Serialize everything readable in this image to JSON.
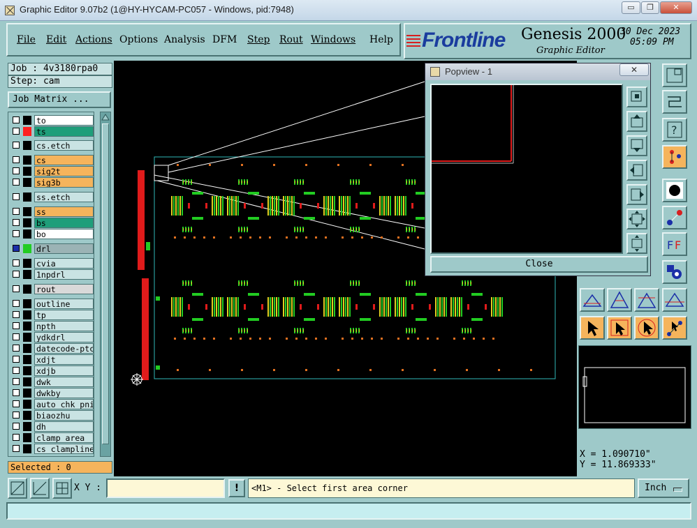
{
  "window": {
    "title": "Graphic Editor 9.07b2 (1@HY-HYCAM-PC057 - Windows, pid:7948)",
    "minimize": "▭",
    "restore": "❐",
    "close": "✕"
  },
  "menu": [
    "File",
    "Edit",
    "Actions",
    "Options",
    "Analysis",
    "DFM",
    "Step",
    "Rout",
    "Windows",
    "Help"
  ],
  "brand": {
    "logo": "Frontline",
    "product": "Genesis 2000",
    "subtitle": "Graphic Editor",
    "date": "30 Dec 2023",
    "time": "05:09 PM"
  },
  "job": {
    "job_label": "Job : 4v3180rpa0",
    "step_label": "Step: cam",
    "job_matrix": "Job Matrix ..."
  },
  "layers": [
    {
      "name": "to",
      "bg": "#ffffff",
      "swatch": "#000000",
      "checked": false
    },
    {
      "name": "ts",
      "bg": "#1e9e7a",
      "swatch": "#ff2020",
      "checked": false
    },
    {
      "name": "cs.etch",
      "bg": "#c9e3e3",
      "swatch": "#000000",
      "checked": false
    },
    {
      "name": "cs",
      "bg": "#f5b45c",
      "swatch": "#000000",
      "checked": false
    },
    {
      "name": "sig2t",
      "bg": "#f5b45c",
      "swatch": "#000000",
      "checked": false
    },
    {
      "name": "sig3b",
      "bg": "#f5b45c",
      "swatch": "#000000",
      "checked": false
    },
    {
      "name": "ss.etch",
      "bg": "#c9e3e3",
      "swatch": "#000000",
      "checked": false
    },
    {
      "name": "ss",
      "bg": "#f5b45c",
      "swatch": "#000000",
      "checked": false
    },
    {
      "name": "bs",
      "bg": "#1e9e7a",
      "swatch": "#000000",
      "checked": false
    },
    {
      "name": "bo",
      "bg": "#ffffff",
      "swatch": "#000000",
      "checked": false
    },
    {
      "name": "drl",
      "bg": "#9bb3b5",
      "swatch": "#22cc22",
      "checked": true
    },
    {
      "name": "cvia",
      "bg": "#c9e3e3",
      "swatch": "#000000",
      "checked": false
    },
    {
      "name": "1npdrl",
      "bg": "#c9e3e3",
      "swatch": "#000000",
      "checked": false
    },
    {
      "name": "rout",
      "bg": "#d9d9d9",
      "swatch": "#000000",
      "checked": false
    },
    {
      "name": "outline",
      "bg": "#c9e3e3",
      "swatch": "#000000",
      "checked": false
    },
    {
      "name": "tp",
      "bg": "#c9e3e3",
      "swatch": "#000000",
      "checked": false
    },
    {
      "name": "npth",
      "bg": "#c9e3e3",
      "swatch": "#000000",
      "checked": false
    },
    {
      "name": "ydkdrl",
      "bg": "#c9e3e3",
      "swatch": "#000000",
      "checked": false
    },
    {
      "name": "datecode-ptc",
      "bg": "#c9e3e3",
      "swatch": "#000000",
      "checked": false
    },
    {
      "name": "xdjt",
      "bg": "#c9e3e3",
      "swatch": "#000000",
      "checked": false
    },
    {
      "name": "xdjb",
      "bg": "#c9e3e3",
      "swatch": "#000000",
      "checked": false
    },
    {
      "name": "dwk",
      "bg": "#c9e3e3",
      "swatch": "#000000",
      "checked": false
    },
    {
      "name": "dwkby",
      "bg": "#c9e3e3",
      "swatch": "#000000",
      "checked": false
    },
    {
      "name": "auto_chk_pni",
      "bg": "#c9e3e3",
      "swatch": "#000000",
      "checked": false
    },
    {
      "name": "biaozhu",
      "bg": "#c9e3e3",
      "swatch": "#000000",
      "checked": false
    },
    {
      "name": "dh",
      "bg": "#c9e3e3",
      "swatch": "#000000",
      "checked": false
    },
    {
      "name": "clamp_area",
      "bg": "#c9e3e3",
      "swatch": "#000000",
      "checked": false
    },
    {
      "name": "cs_clampline",
      "bg": "#c9e3e3",
      "swatch": "#000000",
      "checked": false
    }
  ],
  "selected": "Selected : 0",
  "popview": {
    "title": "Popview - 1",
    "close_x": "✕",
    "close_button": "Close"
  },
  "coords": {
    "x": "X = 1.090710\"",
    "y": "Y = 11.869333\""
  },
  "bottom": {
    "xy_label": "X Y :",
    "xy_value": "",
    "bang": "!",
    "prompt": "<M1> - Select first area corner",
    "unit": "Inch"
  },
  "status": ""
}
